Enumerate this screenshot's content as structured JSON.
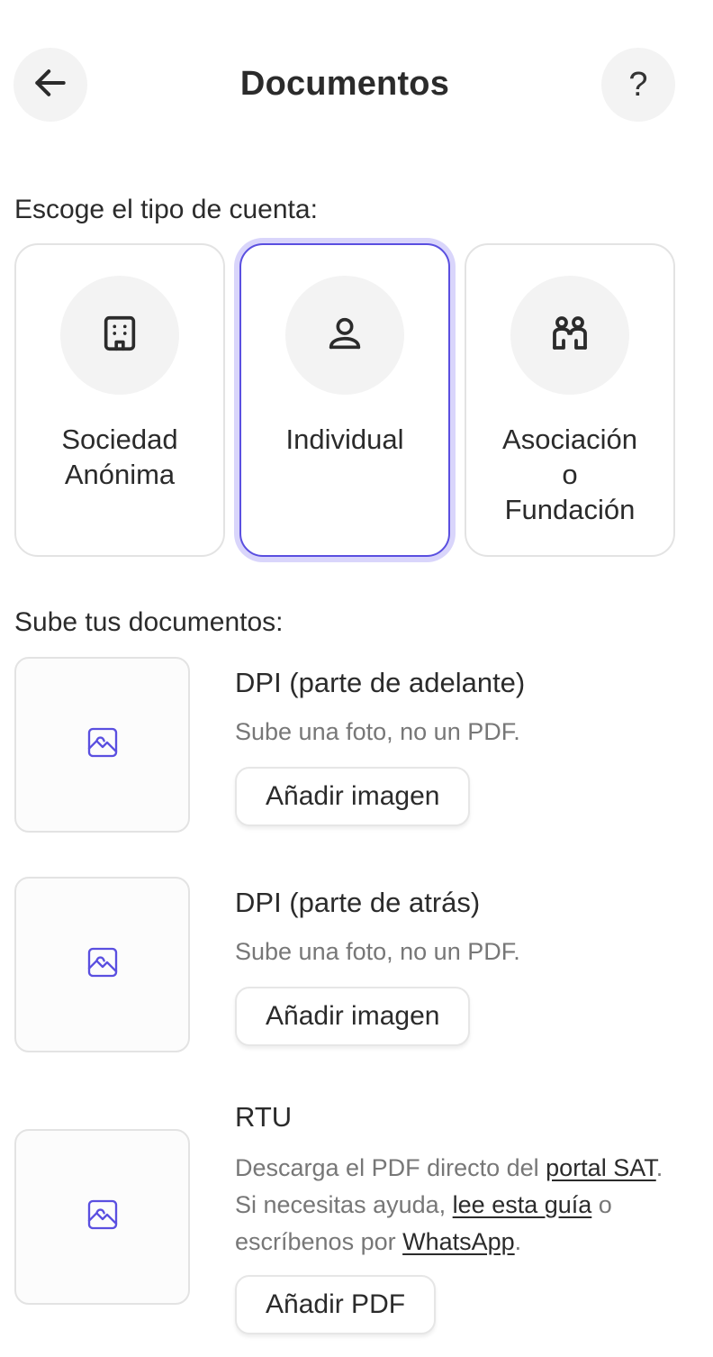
{
  "header": {
    "title": "Documentos",
    "back_icon": "arrow-left-icon",
    "help_label": "?"
  },
  "account_type": {
    "label": "Escoge el tipo de cuenta:",
    "selected": "Individual",
    "accent_color": "#5a4fe0",
    "options": [
      {
        "label": "Sociedad Anónima",
        "icon": "building-icon"
      },
      {
        "label": "Individual",
        "icon": "user-icon"
      },
      {
        "label": "Asociación o Fundación",
        "icon": "users-icon"
      }
    ]
  },
  "documents": {
    "label": "Sube tus documentos:",
    "items": [
      {
        "title": "DPI (parte de adelante)",
        "hint": "Sube una foto, no un PDF.",
        "button": "Añadir imagen",
        "icon": "image-icon"
      },
      {
        "title": "DPI (parte de atrás)",
        "hint": "Sube una foto, no un PDF.",
        "button": "Añadir imagen",
        "icon": "image-icon"
      },
      {
        "title": "RTU",
        "hint_parts": {
          "t1": "Descarga el PDF directo del ",
          "link1": "portal SAT",
          "t2": ". Si necesitas ayuda, ",
          "link2": "lee esta guía",
          "t3": " o escríbenos por ",
          "link3": "WhatsApp",
          "t4": "."
        },
        "button": "Añadir PDF",
        "icon": "image-icon"
      }
    ]
  }
}
